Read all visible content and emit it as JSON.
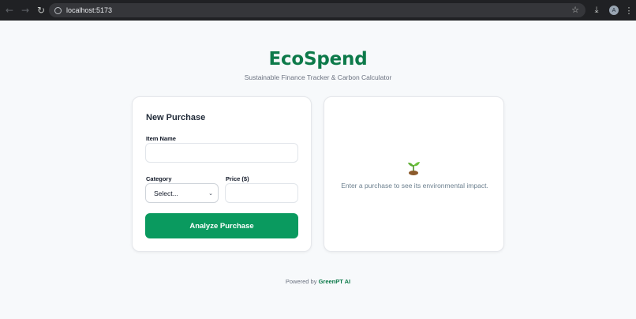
{
  "browser": {
    "url": "localhost:5173",
    "avatar_letter": "A"
  },
  "brand": {
    "title": "EcoSpend",
    "tagline": "Sustainable Finance Tracker & Carbon Calculator"
  },
  "form": {
    "title": "New Purchase",
    "item_name_label": "Item Name",
    "item_name_value": "",
    "category_label": "Category",
    "category_selected": "Select...",
    "price_label": "Price ($)",
    "price_value": "",
    "submit_label": "Analyze Purchase"
  },
  "result": {
    "icon": "sprout-icon",
    "empty_message": "Enter a purchase to see its environmental impact."
  },
  "footer": {
    "prefix": "Powered by",
    "brand": "GreenPT AI"
  },
  "colors": {
    "accent": "#0a9a5f",
    "brand_text": "#0d7a4a",
    "page_bg": "#f7f9fb",
    "chrome_bg": "#202124"
  }
}
